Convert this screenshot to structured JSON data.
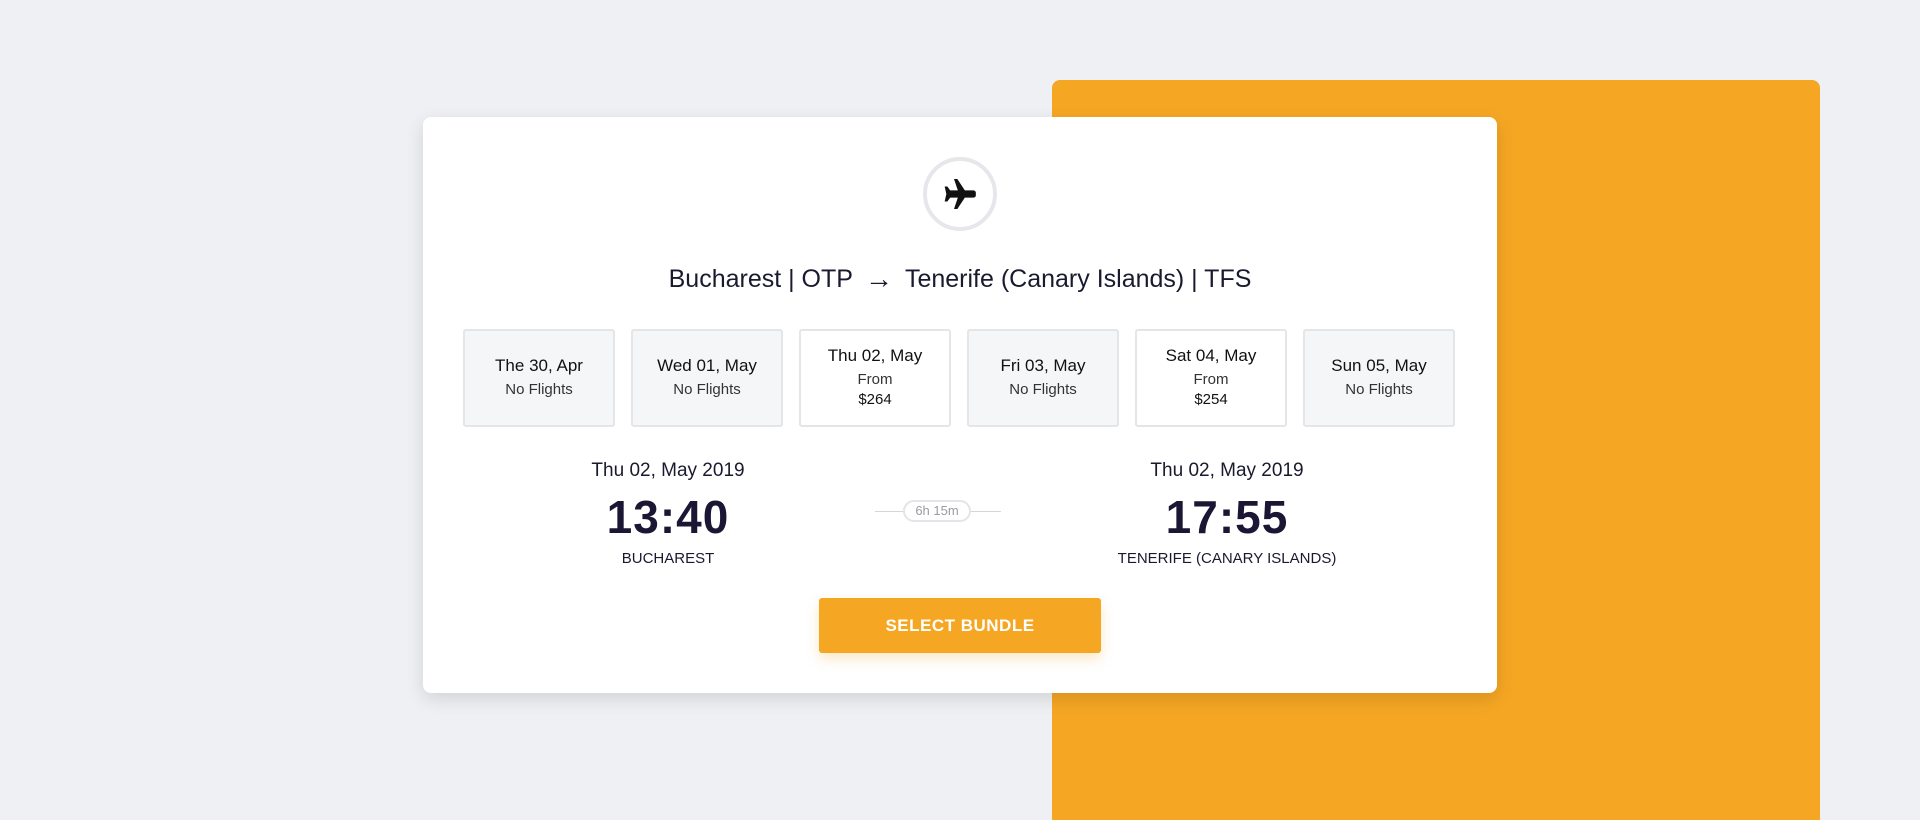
{
  "route": {
    "origin": "Bucharest | OTP",
    "arrow": "→",
    "destination": "Tenerife (Canary Islands) | TFS"
  },
  "dates": [
    {
      "label": "The 30, Apr",
      "status": "No Flights",
      "price": ""
    },
    {
      "label": "Wed 01, May",
      "status": "No Flights",
      "price": ""
    },
    {
      "label": "Thu 02, May",
      "status": "From",
      "price": "$264"
    },
    {
      "label": "Fri 03, May",
      "status": "No Flights",
      "price": ""
    },
    {
      "label": "Sat 04, May",
      "status": "From",
      "price": "$254"
    },
    {
      "label": "Sun 05, May",
      "status": "No Flights",
      "price": ""
    }
  ],
  "departure": {
    "date": "Thu 02, May 2019",
    "time": "13:40",
    "city": "BUCHAREST"
  },
  "arrival": {
    "date": "Thu 02, May 2019",
    "time": "17:55",
    "city": "TENERIFE (CANARY ISLANDS)"
  },
  "duration": "6h 15m",
  "select_button": "SELECT BUNDLE",
  "colors": {
    "accent": "#f5a623",
    "background": "#eff0f4",
    "card": "#ffffff"
  },
  "icons": {
    "badge": "airplane-icon"
  }
}
